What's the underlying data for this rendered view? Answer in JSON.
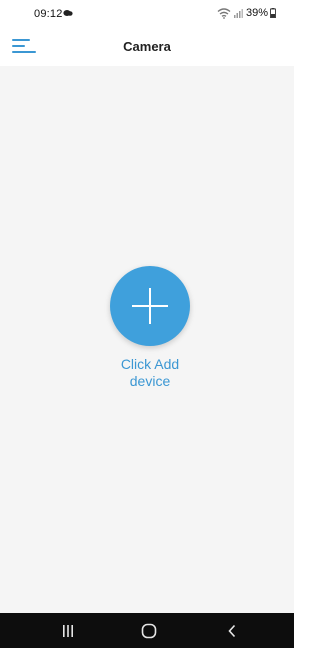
{
  "status_bar": {
    "time": "09:12",
    "battery": "39%"
  },
  "header": {
    "title": "Camera"
  },
  "main": {
    "add_label": "Click Add\ndevice"
  },
  "colors": {
    "accent": "#3fa0dc",
    "content_bg": "#f5f5f5",
    "nav_bg": "#0d0d0d"
  },
  "icons": {
    "menu": "hamburger-menu-icon",
    "add": "plus-icon",
    "nav_recent": "recent-apps-icon",
    "nav_home": "home-icon",
    "nav_back": "back-icon"
  }
}
